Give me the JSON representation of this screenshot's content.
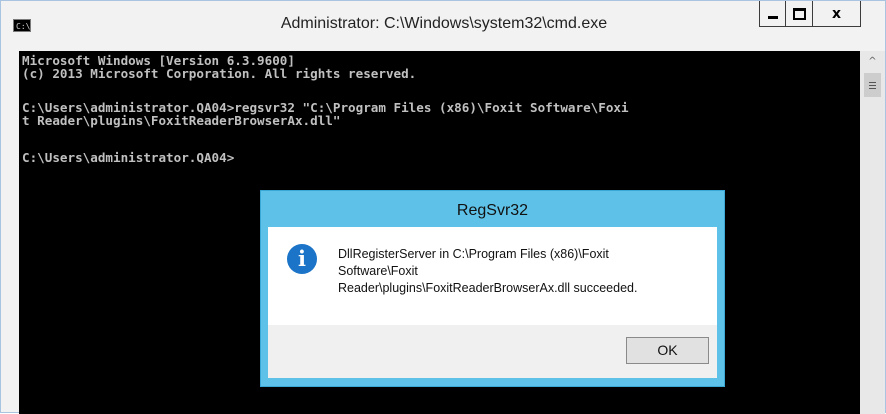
{
  "window": {
    "title": "Administrator: C:\\Windows\\system32\\cmd.exe",
    "icon": "cmd-icon",
    "icon_text": "C:\\",
    "controls": {
      "minimize": "minimize-icon",
      "maximize": "maximize-icon",
      "close": "x"
    }
  },
  "console": {
    "lines": [
      "Microsoft Windows [Version 6.3.9600]",
      "(c) 2013 Microsoft Corporation. All rights reserved.",
      "",
      "C:\\Users\\administrator.QA04>regsvr32 \"C:\\Program Files (x86)\\Foxit Software\\Foxi",
      "t Reader\\plugins\\FoxitReaderBrowserAx.dll\"",
      "",
      "C:\\Users\\administrator.QA04>"
    ],
    "foreground": "#c0c0c0",
    "background": "#000000"
  },
  "scrollbar": {
    "up_arrow": "^"
  },
  "dialog": {
    "title": "RegSvr32",
    "icon": "info-icon",
    "icon_glyph": "i",
    "message_lines": [
      "DllRegisterServer in C:\\Program Files (x86)\\Foxit",
      "Software\\Foxit",
      "Reader\\plugins\\FoxitReaderBrowserAx.dll succeeded."
    ],
    "ok_label": "OK",
    "accent": "#5ec2e8"
  }
}
